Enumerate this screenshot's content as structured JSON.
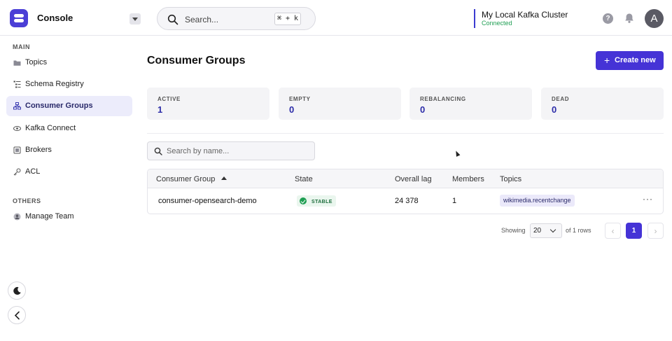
{
  "header": {
    "app_title": "Console",
    "search_placeholder": "Search...",
    "search_shortcut": "⌘ + k",
    "cluster_name": "My Local Kafka Cluster",
    "cluster_status": "Connected",
    "help_glyph": "?",
    "avatar_initial": "A"
  },
  "sidebar": {
    "main_label": "MAIN",
    "main_items": [
      {
        "label": "Topics",
        "icon": "folder-icon"
      },
      {
        "label": "Schema Registry",
        "icon": "list-tree-icon"
      },
      {
        "label": "Consumer Groups",
        "icon": "group-hierarchy-icon",
        "active": true
      },
      {
        "label": "Kafka Connect",
        "icon": "link-icon"
      },
      {
        "label": "Brokers",
        "icon": "server-icon"
      },
      {
        "label": "ACL",
        "icon": "key-icon"
      }
    ],
    "others_label": "OTHERS",
    "others_items": [
      {
        "label": "Manage Team",
        "icon": "user-circle-icon"
      }
    ]
  },
  "main": {
    "page_title": "Consumer Groups",
    "create_button": "Create new",
    "stats": [
      {
        "label": "ACTIVE",
        "value": "1"
      },
      {
        "label": "EMPTY",
        "value": "0"
      },
      {
        "label": "REBALANCING",
        "value": "0"
      },
      {
        "label": "DEAD",
        "value": "0"
      }
    ],
    "filter_placeholder": "Search by name...",
    "table": {
      "columns": [
        "Consumer Group",
        "State",
        "Overall lag",
        "Members",
        "Topics"
      ],
      "rows": [
        {
          "group": "consumer-opensearch-demo",
          "state": "STABLE",
          "lag": "24 378",
          "members": "1",
          "topic": "wikimedia.recentchange",
          "menu": "···"
        }
      ]
    },
    "pagination": {
      "showing_label": "Showing",
      "page_size": "20",
      "of_label": "of 1 rows",
      "current_page": "1",
      "prev": "‹",
      "next": "›"
    }
  },
  "colors": {
    "accent": "#4533d6",
    "success": "#1e9e52",
    "active_nav_bg": "#ececfb"
  }
}
